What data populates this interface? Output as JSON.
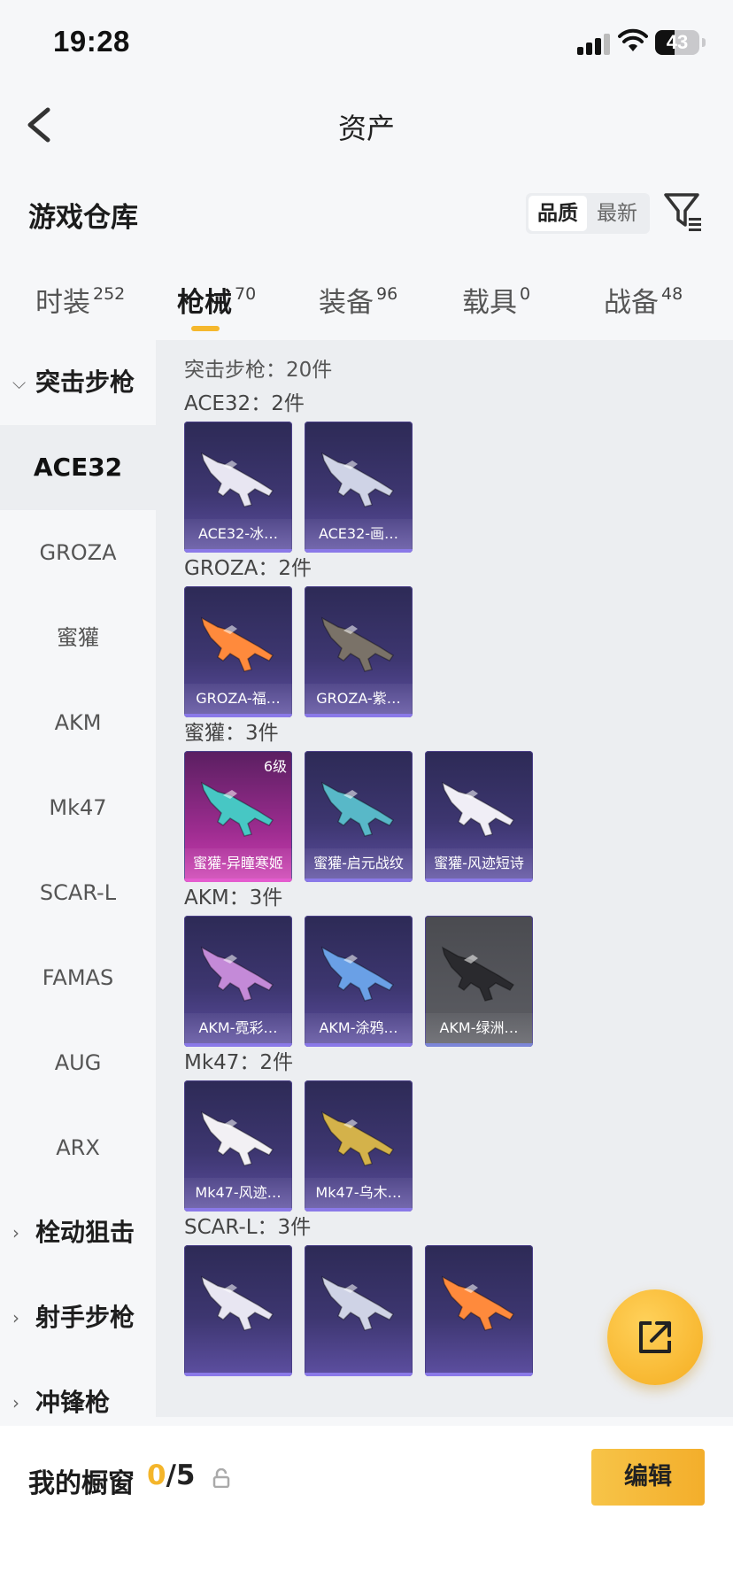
{
  "status_bar": {
    "time": "19:28",
    "battery": "43",
    "battery_level": 0.43
  },
  "nav": {
    "title": "资产"
  },
  "header": {
    "title": "游戏仓库",
    "sort_options": [
      "品质",
      "最新"
    ],
    "active_sort": "品质"
  },
  "category_tabs": [
    {
      "label": "时装",
      "count": "252"
    },
    {
      "label": "枪械",
      "count": "70"
    },
    {
      "label": "装备",
      "count": "96"
    },
    {
      "label": "载具",
      "count": "0"
    },
    {
      "label": "战备",
      "count": "48"
    }
  ],
  "active_tab": "枪械",
  "sidebar": {
    "groups": [
      {
        "label": "突击步枪",
        "expanded": true
      },
      {
        "label": "栓动狙击",
        "expanded": false
      },
      {
        "label": "射手步枪",
        "expanded": false
      },
      {
        "label": "冲锋枪",
        "expanded": false
      }
    ],
    "items": [
      "ACE32",
      "GROZA",
      "蜜獾",
      "AKM",
      "Mk47",
      "SCAR-L",
      "FAMAS",
      "AUG",
      "ARX"
    ],
    "active_item": "ACE32"
  },
  "content": {
    "section_total": "突击步枪：20件",
    "groups": [
      {
        "title": "ACE32：2件",
        "cards": [
          {
            "label": "ACE32-冰…",
            "style": "purple"
          },
          {
            "label": "ACE32-画…",
            "style": "purple"
          }
        ]
      },
      {
        "title": "GROZA：2件",
        "cards": [
          {
            "label": "GROZA-福…",
            "style": "purple"
          },
          {
            "label": "GROZA-紫…",
            "style": "purple"
          }
        ]
      },
      {
        "title": "蜜獾：3件",
        "cards": [
          {
            "label": "蜜獾-异瞳寒姬",
            "style": "pink",
            "level": "6级"
          },
          {
            "label": "蜜獾-启元战纹",
            "style": "purple"
          },
          {
            "label": "蜜獾-风迹短诗",
            "style": "purple"
          }
        ]
      },
      {
        "title": "AKM：3件",
        "cards": [
          {
            "label": "AKM-霓彩…",
            "style": "purple"
          },
          {
            "label": "AKM-涂鸦…",
            "style": "purple"
          },
          {
            "label": "AKM-绿洲…",
            "style": "gray"
          }
        ]
      },
      {
        "title": "Mk47：2件",
        "cards": [
          {
            "label": "Mk47-风迹…",
            "style": "purple"
          },
          {
            "label": "Mk47-乌木…",
            "style": "purple"
          }
        ]
      },
      {
        "title": "SCAR-L：3件",
        "cards": [
          {
            "label": "",
            "style": "purple"
          },
          {
            "label": "",
            "style": "purple"
          },
          {
            "label": "",
            "style": "purple"
          }
        ]
      }
    ]
  },
  "bottom_bar": {
    "showcase_label": "我的橱窗",
    "showcase_current": "0",
    "showcase_total": "/5",
    "edit_label": "编辑"
  },
  "icons": {
    "back": "chevron-left-icon",
    "filter": "filter-icon",
    "lock": "lock-icon",
    "share": "share-external-icon"
  },
  "colors": {
    "accent": "#f5b82e",
    "card_purple": "#3d3670",
    "card_pink": "#9c2c8f"
  }
}
